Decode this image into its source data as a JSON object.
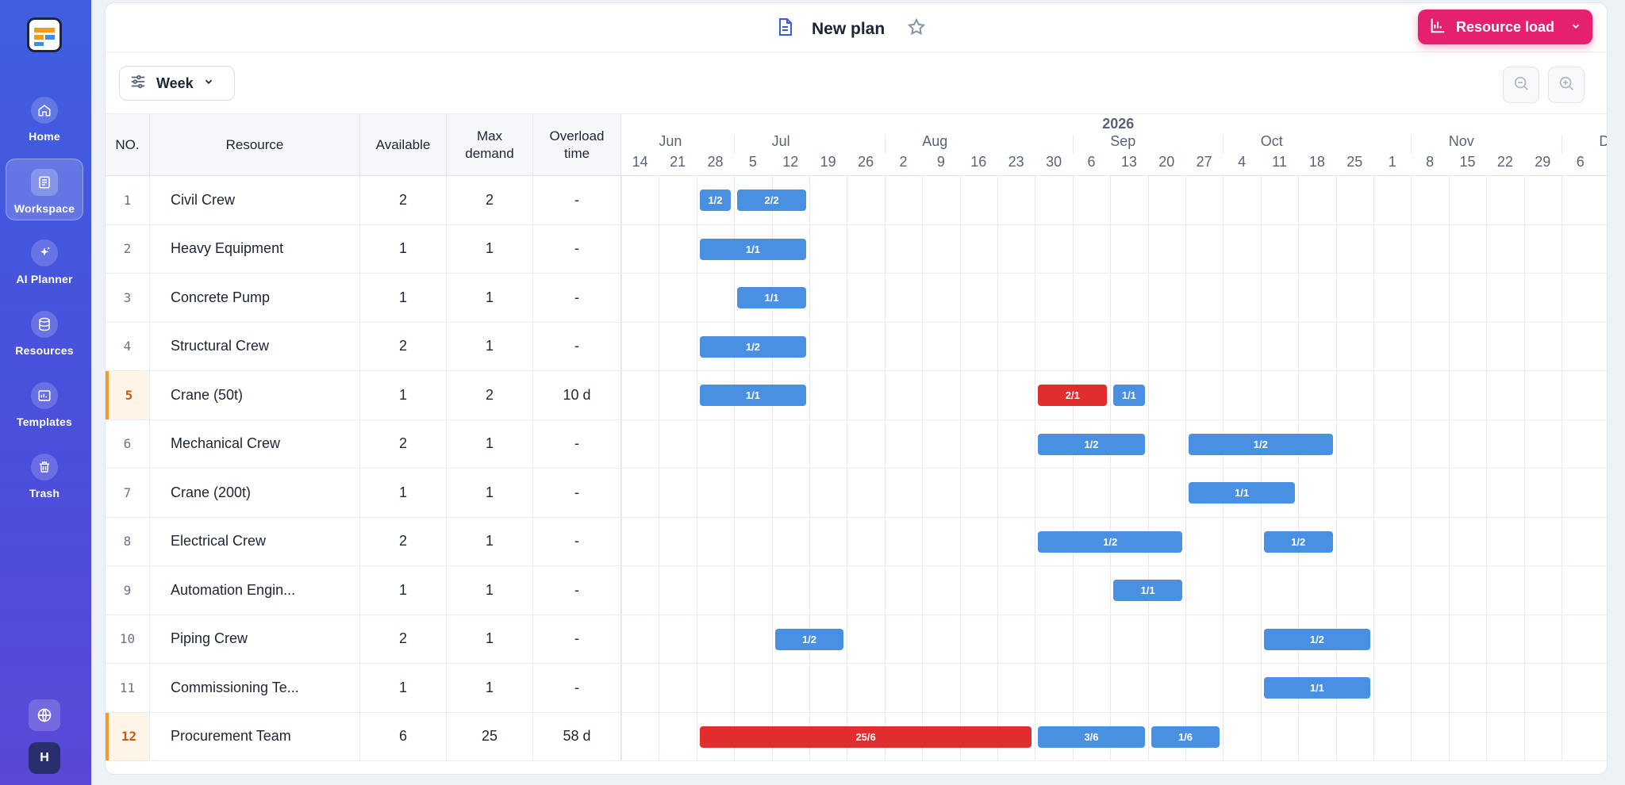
{
  "sidebar": {
    "items": [
      {
        "label": "Home",
        "icon": "home-icon"
      },
      {
        "label": "Workspace",
        "icon": "workspace-icon",
        "active": true
      },
      {
        "label": "AI Planner",
        "icon": "sparkle-icon"
      },
      {
        "label": "Resources",
        "icon": "database-icon"
      },
      {
        "label": "Templates",
        "icon": "template-icon"
      },
      {
        "label": "Trash",
        "icon": "trash-icon"
      }
    ],
    "avatar": "H"
  },
  "header": {
    "title": "New plan",
    "resource_button": "Resource load"
  },
  "toolbar": {
    "view": "Week"
  },
  "table": {
    "headers": {
      "no": "NO.",
      "resource": "Resource",
      "available": "Available",
      "max_demand": "Max demand",
      "overload": "Overload time"
    },
    "rows": [
      {
        "no": "1",
        "resource": "Civil Crew",
        "available": "2",
        "max": "2",
        "overload": "-"
      },
      {
        "no": "2",
        "resource": "Heavy Equipment",
        "available": "1",
        "max": "1",
        "overload": "-"
      },
      {
        "no": "3",
        "resource": "Concrete Pump",
        "available": "1",
        "max": "1",
        "overload": "-"
      },
      {
        "no": "4",
        "resource": "Structural Crew",
        "available": "2",
        "max": "1",
        "overload": "-"
      },
      {
        "no": "5",
        "resource": "Crane (50t)",
        "available": "1",
        "max": "2",
        "overload": "10 d",
        "flag": true
      },
      {
        "no": "6",
        "resource": "Mechanical Crew",
        "available": "2",
        "max": "1",
        "overload": "-"
      },
      {
        "no": "7",
        "resource": "Crane (200t)",
        "available": "1",
        "max": "1",
        "overload": "-"
      },
      {
        "no": "8",
        "resource": "Electrical Crew",
        "available": "2",
        "max": "1",
        "overload": "-"
      },
      {
        "no": "9",
        "resource": "Automation Engin...",
        "available": "1",
        "max": "1",
        "overload": "-"
      },
      {
        "no": "10",
        "resource": "Piping Crew",
        "available": "2",
        "max": "1",
        "overload": "-"
      },
      {
        "no": "11",
        "resource": "Commissioning Te...",
        "available": "1",
        "max": "1",
        "overload": "-"
      },
      {
        "no": "12",
        "resource": "Procurement Team",
        "available": "6",
        "max": "25",
        "overload": "58 d",
        "flag": true
      }
    ]
  },
  "gantt": {
    "year": "2026",
    "months": [
      {
        "label": "Jun",
        "at_col": 0
      },
      {
        "label": "Jul",
        "at_col": 3
      },
      {
        "label": "Aug",
        "at_col": 7
      },
      {
        "label": "Sep",
        "at_col": 12
      },
      {
        "label": "Oct",
        "at_col": 16
      },
      {
        "label": "Nov",
        "at_col": 21
      },
      {
        "label": "Dec",
        "at_col": 25
      }
    ],
    "weeks": [
      "14",
      "21",
      "28",
      "5",
      "12",
      "19",
      "26",
      "2",
      "9",
      "16",
      "23",
      "30",
      "6",
      "13",
      "20",
      "27",
      "4",
      "11",
      "18",
      "25",
      "1",
      "8",
      "15",
      "22",
      "29",
      "6"
    ],
    "bars": [
      {
        "row": 0,
        "start": 2,
        "end": 3,
        "label": "1/2"
      },
      {
        "row": 0,
        "start": 3,
        "end": 5,
        "label": "2/2"
      },
      {
        "row": 1,
        "start": 2,
        "end": 5,
        "label": "1/1"
      },
      {
        "row": 2,
        "start": 3,
        "end": 5,
        "label": "1/1"
      },
      {
        "row": 3,
        "start": 2,
        "end": 5,
        "label": "1/2"
      },
      {
        "row": 4,
        "start": 2,
        "end": 5,
        "label": "1/1"
      },
      {
        "row": 4,
        "start": 11,
        "end": 13,
        "label": "2/1",
        "overload": true
      },
      {
        "row": 4,
        "start": 13,
        "end": 14,
        "label": "1/1"
      },
      {
        "row": 5,
        "start": 11,
        "end": 14,
        "label": "1/2"
      },
      {
        "row": 5,
        "start": 15,
        "end": 19,
        "label": "1/2"
      },
      {
        "row": 6,
        "start": 15,
        "end": 18,
        "label": "1/1"
      },
      {
        "row": 7,
        "start": 11,
        "end": 15,
        "label": "1/2"
      },
      {
        "row": 7,
        "start": 17,
        "end": 19,
        "label": "1/2"
      },
      {
        "row": 8,
        "start": 13,
        "end": 15,
        "label": "1/1"
      },
      {
        "row": 9,
        "start": 4,
        "end": 6,
        "label": "1/2"
      },
      {
        "row": 9,
        "start": 17,
        "end": 20,
        "label": "1/2"
      },
      {
        "row": 10,
        "start": 17,
        "end": 20,
        "label": "1/1"
      },
      {
        "row": 11,
        "start": 2,
        "end": 11,
        "label": "25/6",
        "overload": true
      },
      {
        "row": 11,
        "start": 11,
        "end": 14,
        "label": "3/6"
      },
      {
        "row": 11,
        "start": 14,
        "end": 16,
        "label": "1/6"
      }
    ]
  },
  "colors": {
    "accent": "#e5206f",
    "bar": "#4a90e2",
    "overload": "#e12d2d",
    "sidebar": "#4650dc"
  }
}
